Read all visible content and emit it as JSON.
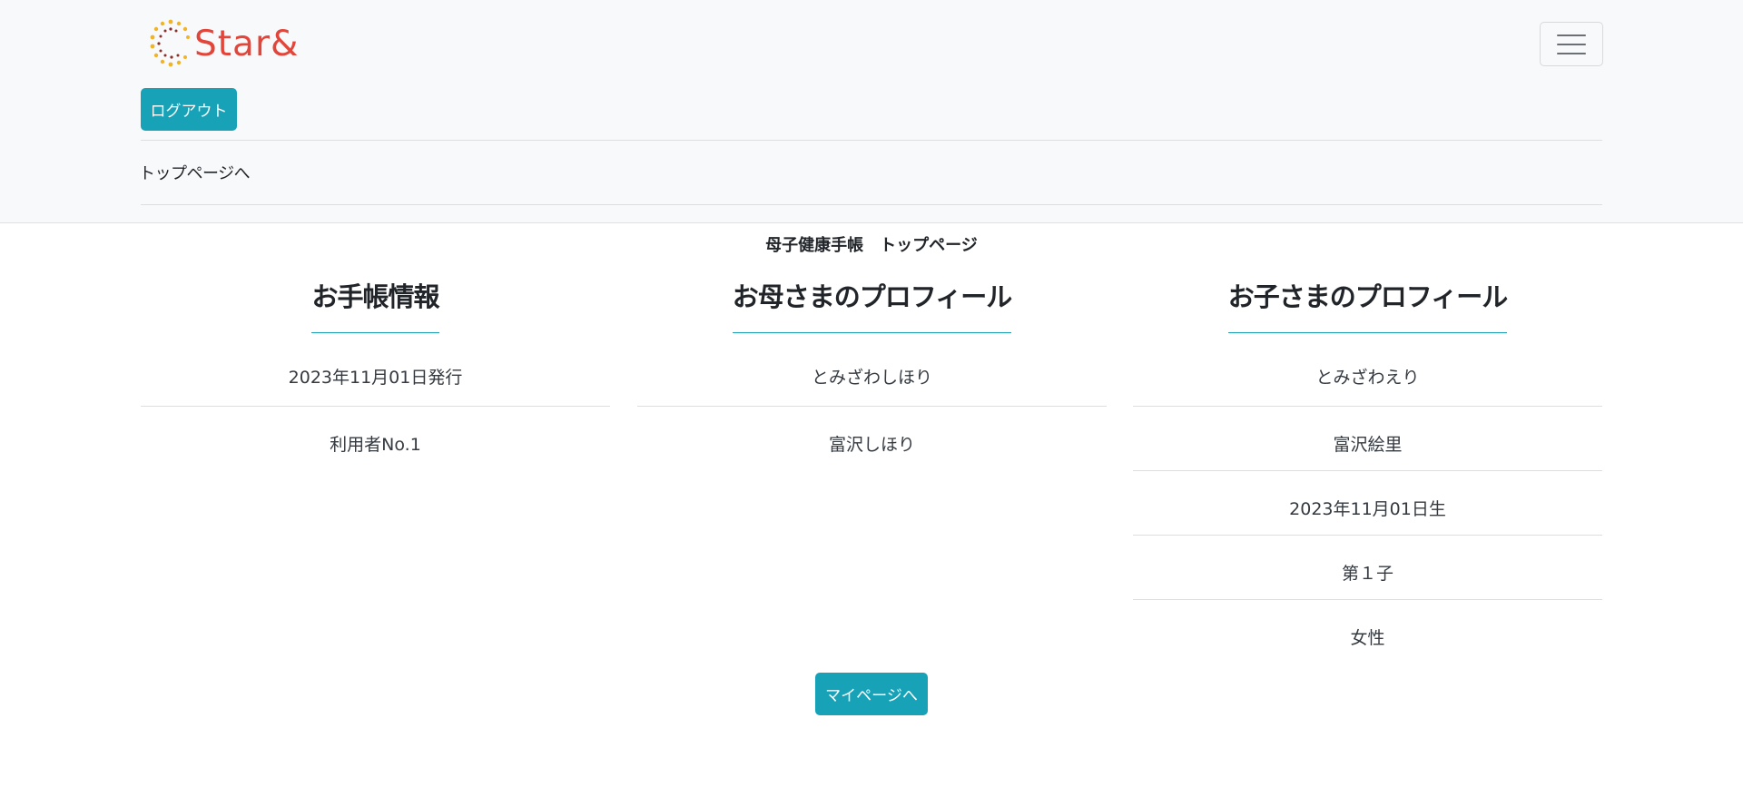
{
  "header": {
    "logo_text": "Star&",
    "logout_label": "ログアウト",
    "top_link_label": "トップページへ"
  },
  "page": {
    "title": "母子健康手帳　トップページ"
  },
  "columns": [
    {
      "heading": "お手帳情報",
      "items": [
        "2023年11月01日発行",
        "利用者No.1"
      ]
    },
    {
      "heading": "お母さまのプロフィール",
      "items": [
        "とみざわしほり",
        "富沢しほり"
      ]
    },
    {
      "heading": "お子さまのプロフィール",
      "items": [
        "とみざわえり",
        "富沢絵里",
        "2023年11月01日生",
        "第１子",
        "女性"
      ]
    }
  ],
  "footer": {
    "mypage_label": "マイページへ"
  },
  "colors": {
    "accent": "#17a2b8",
    "logo_red": "#e2463b",
    "navbar_bg": "#f8f9fa"
  }
}
